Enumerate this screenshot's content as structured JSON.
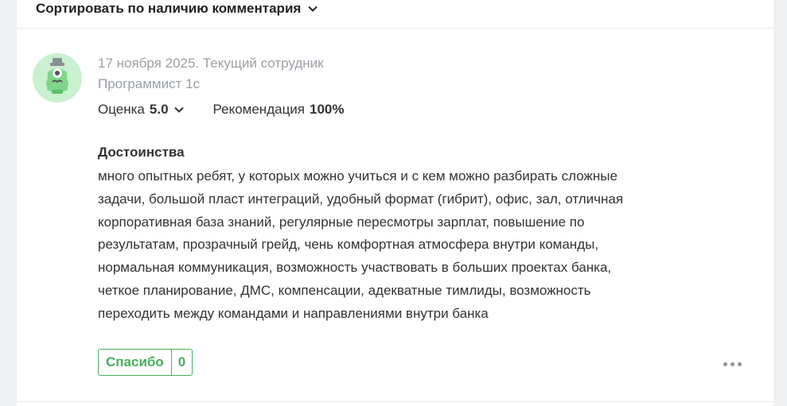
{
  "sort": {
    "label": "Сортировать по наличию комментария"
  },
  "review": {
    "meta_line": "17 ноября 2025. Текущий сотрудник",
    "position": "Программист 1с",
    "rating_label": "Оценка",
    "rating_value": "5.0",
    "recommendation_label": "Рекомендация",
    "recommendation_value": "100%",
    "section_title": "Достоинства",
    "section_text": "много опытных ребят, у которых можно учиться и с кем можно разбирать сложные задачи, большой пласт интеграций, удобный формат (гибрит), офис, зал, отличная корпоративная база знаний, регулярные пересмотры зарплат, повышение по результатам, прозрачный грейд, чень комфортная атмосфера внутри команды, нормальная коммуникация, возможность участвовать в больших проектах банка, четкое планирование, ДМС, компенсации, адекватные тимлиды, возможность переходить между командами и направлениями внутри банка",
    "thanks_label": "Спасибо",
    "thanks_count": "0"
  },
  "colors": {
    "accent": "#45b15b",
    "muted": "#9aa0a6",
    "avatar_bg": "#c9f0cf"
  },
  "icons": {
    "sort": "chevron-down-icon",
    "avatar": "owl-avatar-icon",
    "more": "more-dots-icon"
  }
}
